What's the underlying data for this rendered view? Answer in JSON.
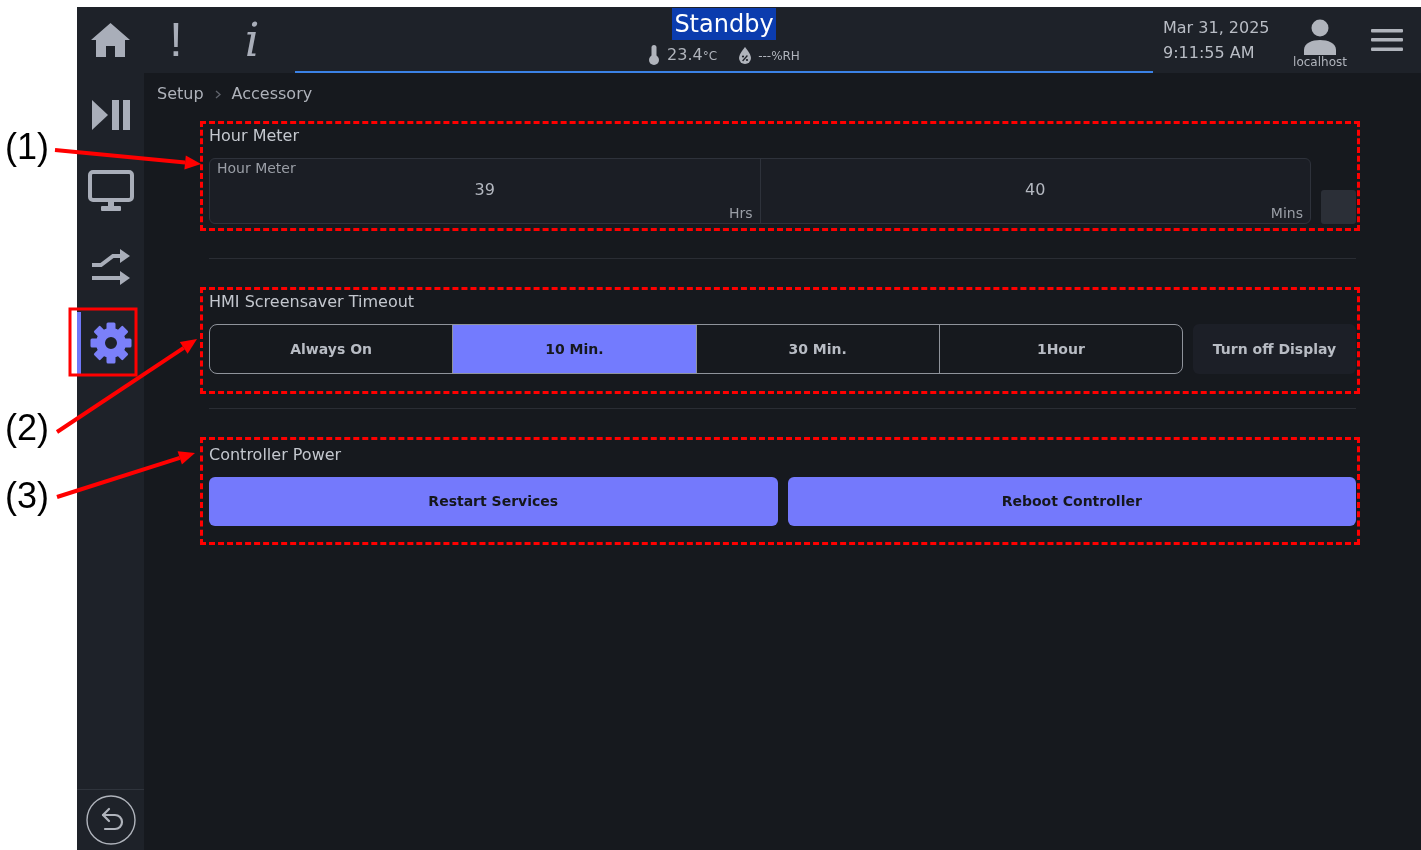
{
  "top_bar": {
    "glyph_buttons": [
      {
        "kind": "alert",
        "glyph": "!"
      },
      {
        "kind": "info",
        "glyph": "i"
      }
    ],
    "status": {
      "text": "Standby",
      "highlighted": true
    },
    "temperature": {
      "value": "23.4",
      "unit": "°C"
    },
    "humidity": {
      "value": "---",
      "unit": "%RH"
    },
    "date": "Mar 31, 2025",
    "time": "9:11:55 AM",
    "user": "localhost"
  },
  "sidebar": {
    "items": [
      {
        "kind": "play-pause",
        "selected": false
      },
      {
        "kind": "monitor",
        "selected": false
      },
      {
        "kind": "transfer",
        "selected": false
      },
      {
        "kind": "settings",
        "selected": true
      }
    ]
  },
  "breadcrumb": [
    "Setup",
    "Accessory"
  ],
  "sections": [
    {
      "kind": "hour-meter",
      "title": "Hour Meter",
      "field_label": "Hour Meter",
      "parts": [
        {
          "value": "39",
          "unit": "Hrs"
        },
        {
          "value": "40",
          "unit": "Mins"
        }
      ]
    },
    {
      "kind": "segmented",
      "title": "HMI Screensaver Timeout",
      "options": [
        {
          "label": "Always On",
          "selected": false
        },
        {
          "label": "10 Min.",
          "selected": true
        },
        {
          "label": "30 Min.",
          "selected": false
        },
        {
          "label": "1Hour",
          "selected": false
        }
      ],
      "side_button": "Turn off Display"
    },
    {
      "kind": "buttons",
      "title": "Controller Power",
      "buttons": [
        "Restart Services",
        "Reboot Controller"
      ]
    }
  ],
  "annotations": [
    {
      "label": "(1)"
    },
    {
      "label": "(2)"
    },
    {
      "label": "(3)"
    }
  ]
}
